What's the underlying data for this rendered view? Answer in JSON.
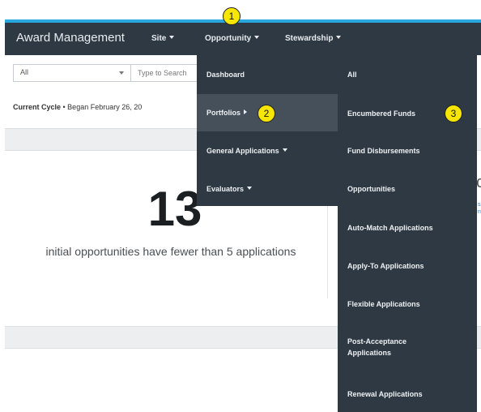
{
  "navbar": {
    "brand": "Award Management",
    "items": [
      {
        "label": "Site"
      },
      {
        "label": "Opportunity"
      },
      {
        "label": "Stewardship"
      }
    ]
  },
  "callouts": [
    "1",
    "2",
    "3"
  ],
  "filters": {
    "select_value": "All",
    "search_placeholder": "Type to Search"
  },
  "cycle": {
    "label": "Current Cycle",
    "text": " • Began February 26, 20"
  },
  "stat": {
    "value": "13",
    "caption": "initial opportunities have fewer than 5 applications"
  },
  "right_fragment": "c",
  "right_fragment_lines": [
    "s",
    "n"
  ],
  "dropdown": {
    "left_items": [
      {
        "label": "Dashboard"
      },
      {
        "label": "Portfolios"
      },
      {
        "label": "General Applications"
      },
      {
        "label": "Evaluators"
      }
    ],
    "right_items": [
      {
        "label": "All"
      },
      {
        "label": "Encumbered Funds"
      },
      {
        "label": "Fund Disbursements"
      },
      {
        "label": "Opportunities"
      },
      {
        "label": "Auto-Match Applications"
      },
      {
        "label": "Apply-To Applications"
      },
      {
        "label": "Flexible Applications"
      },
      {
        "label": "Post-Acceptance Applications"
      },
      {
        "label": "Renewal Applications"
      }
    ]
  },
  "colors": {
    "navbar": "#2f3943",
    "accent_line": "#29a8e0",
    "badge": "#f7e600"
  }
}
